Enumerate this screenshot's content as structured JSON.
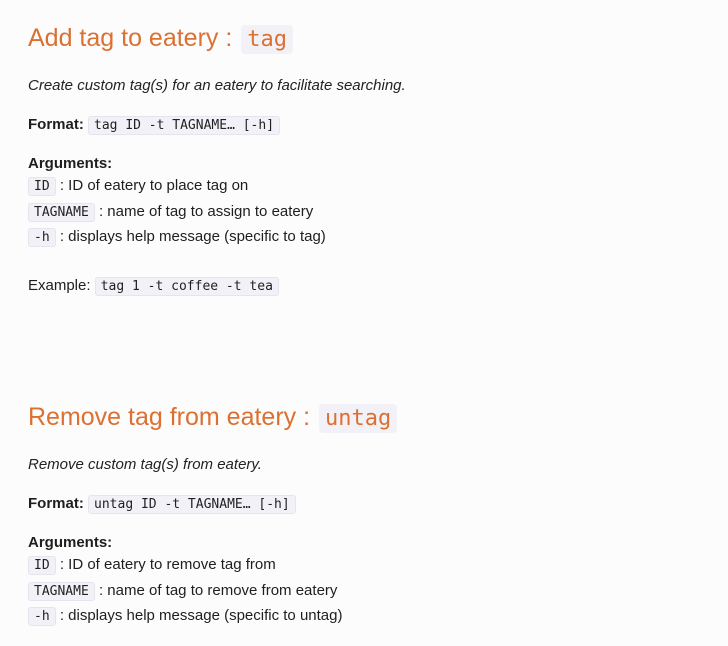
{
  "sections": [
    {
      "title": "Add tag to eatery :",
      "command": "tag",
      "description": "Create custom tag(s) for an eatery to facilitate searching.",
      "format_label": "Format:",
      "format_code": "tag ID -t TAGNAME… [-h]",
      "arguments_label": "Arguments:",
      "arguments": [
        {
          "name": "ID",
          "desc": ": ID of eatery to place tag on"
        },
        {
          "name": "TAGNAME",
          "desc": ": name of tag to assign to eatery"
        },
        {
          "name": "-h",
          "desc": ": displays help message (specific to tag)"
        }
      ],
      "example_label": "Example:",
      "example_code": "tag 1 -t coffee -t tea"
    },
    {
      "title": "Remove tag from eatery :",
      "command": "untag",
      "description": "Remove custom tag(s) from eatery.",
      "format_label": "Format:",
      "format_code": "untag ID -t TAGNAME… [-h]",
      "arguments_label": "Arguments:",
      "arguments": [
        {
          "name": "ID",
          "desc": ": ID of eatery to remove tag from"
        },
        {
          "name": "TAGNAME",
          "desc": ": name of tag to remove from eatery"
        },
        {
          "name": "-h",
          "desc": ": displays help message (specific to untag)"
        }
      ]
    }
  ],
  "colors": {
    "heading": "#dc7031",
    "code_background": "#f2f1f7",
    "page_background": "#fcfcfd"
  }
}
